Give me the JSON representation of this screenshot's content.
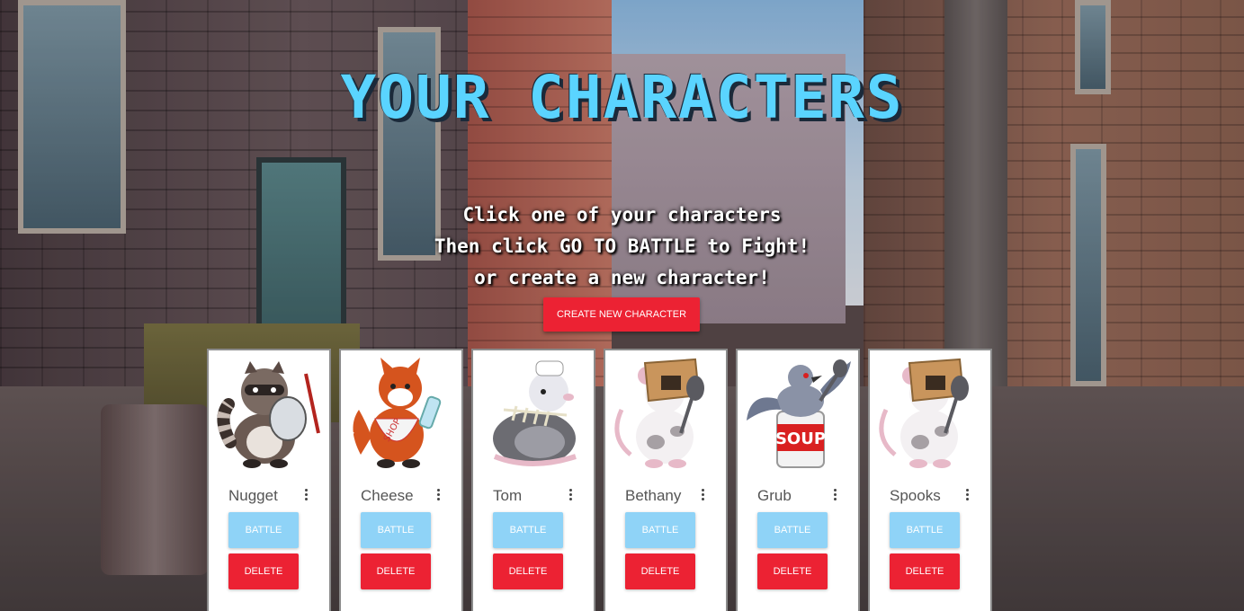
{
  "page": {
    "title": "YOUR CHARACTERS",
    "instructions": [
      "Click one of your characters",
      "Then click GO TO BATTLE to Fight!",
      "or create a new character!"
    ],
    "create_button": "CREATE NEW CHARACTER"
  },
  "characters": [
    {
      "name": "Nugget",
      "art": "raccoon-with-lid-icon",
      "battle_label": "BATTLE",
      "delete_label": "DELETE"
    },
    {
      "name": "Cheese",
      "art": "fox-with-bottle-icon",
      "battle_label": "BATTLE",
      "delete_label": "DELETE"
    },
    {
      "name": "Tom",
      "art": "possum-chef-with-fishbone-icon",
      "battle_label": "BATTLE",
      "delete_label": "DELETE"
    },
    {
      "name": "Bethany",
      "art": "rat-in-box-with-spoon-icon",
      "battle_label": "BATTLE",
      "delete_label": "DELETE"
    },
    {
      "name": "Grub",
      "art": "pigeon-on-soup-can-icon",
      "battle_label": "BATTLE",
      "delete_label": "DELETE",
      "can_text": "SOUP"
    },
    {
      "name": "Spooks",
      "art": "rat-in-box-with-spoon-icon",
      "battle_label": "BATTLE",
      "delete_label": "DELETE"
    }
  ],
  "colors": {
    "title": "#5ad4ff",
    "battle_button": "#8fd3f7",
    "delete_button": "#ec2233",
    "create_button": "#ec2233"
  }
}
